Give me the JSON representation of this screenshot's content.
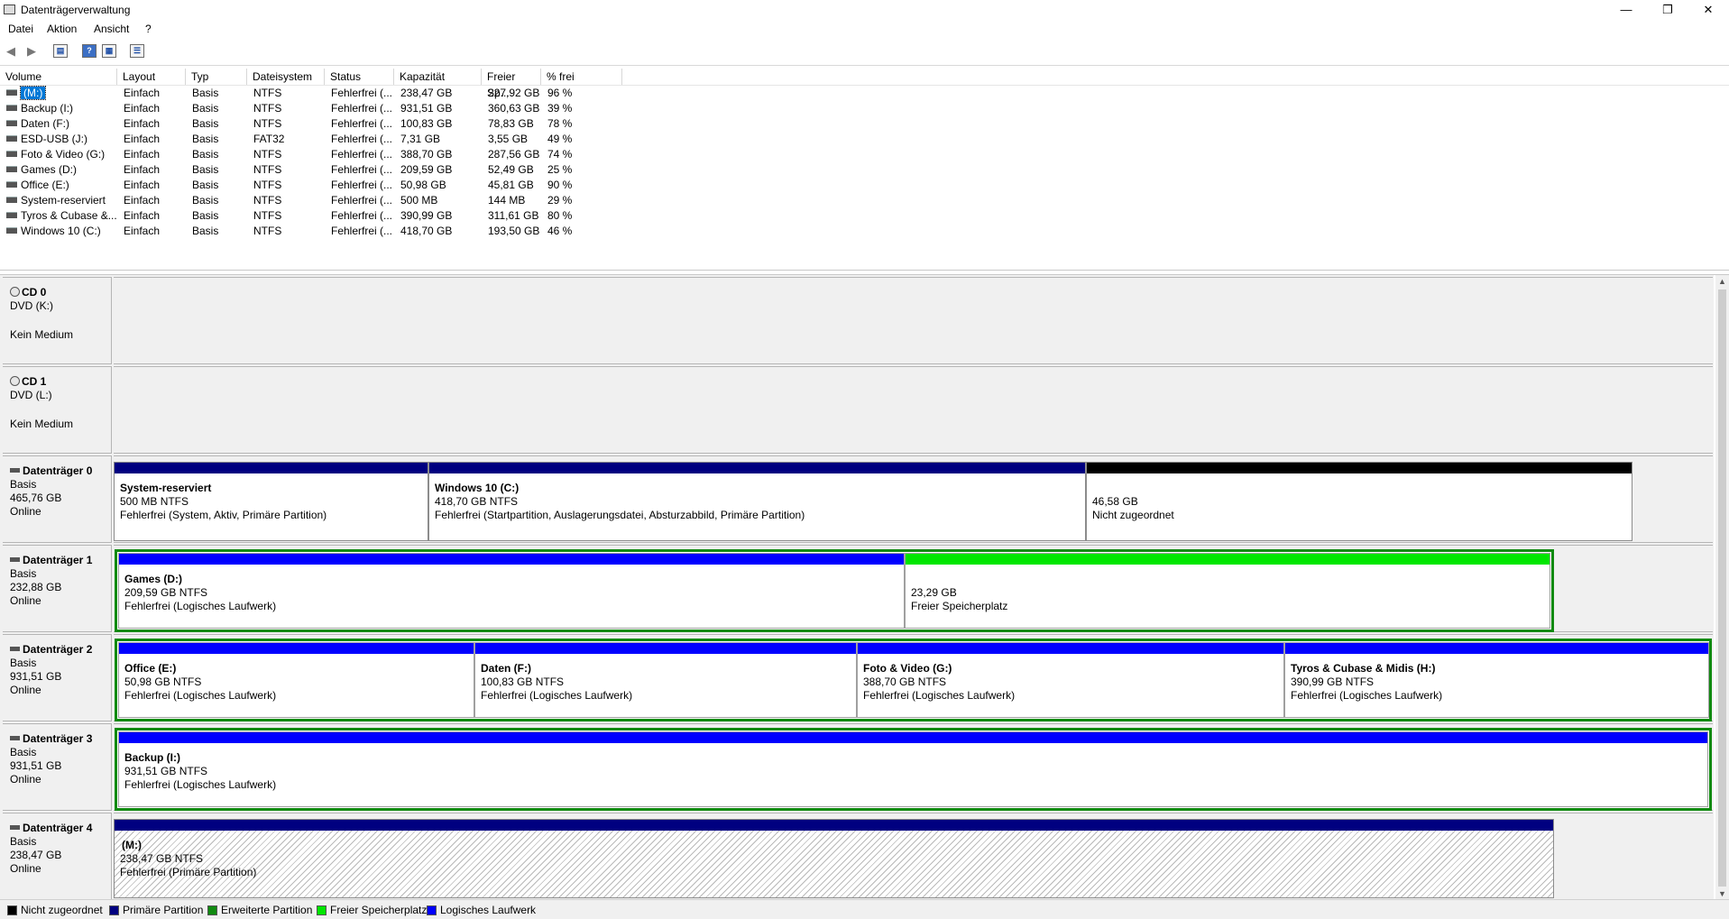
{
  "window": {
    "title": "Datenträgerverwaltung",
    "minimize": "—",
    "restore": "❐",
    "close": "✕"
  },
  "menu": [
    "Datei",
    "Aktion",
    "Ansicht",
    "?"
  ],
  "toolbar": {
    "back": "back-icon",
    "forward": "forward-icon",
    "help_label": "?"
  },
  "volume_list": {
    "headers": [
      "Volume",
      "Layout",
      "Typ",
      "Dateisystem",
      "Status",
      "Kapazität",
      "Freier Sp...",
      "% frei"
    ],
    "rows": [
      [
        "(M:)",
        "Einfach",
        "Basis",
        "NTFS",
        "Fehlerfrei (...",
        "238,47 GB",
        "227,92 GB",
        "96 %"
      ],
      [
        "Backup (I:)",
        "Einfach",
        "Basis",
        "NTFS",
        "Fehlerfrei (...",
        "931,51 GB",
        "360,63 GB",
        "39 %"
      ],
      [
        "Daten (F:)",
        "Einfach",
        "Basis",
        "NTFS",
        "Fehlerfrei (...",
        "100,83 GB",
        "78,83 GB",
        "78 %"
      ],
      [
        "ESD-USB (J:)",
        "Einfach",
        "Basis",
        "FAT32",
        "Fehlerfrei (...",
        "7,31 GB",
        "3,55 GB",
        "49 %"
      ],
      [
        "Foto & Video (G:)",
        "Einfach",
        "Basis",
        "NTFS",
        "Fehlerfrei (...",
        "388,70 GB",
        "287,56 GB",
        "74 %"
      ],
      [
        "Games (D:)",
        "Einfach",
        "Basis",
        "NTFS",
        "Fehlerfrei (...",
        "209,59 GB",
        "52,49 GB",
        "25 %"
      ],
      [
        "Office (E:)",
        "Einfach",
        "Basis",
        "NTFS",
        "Fehlerfrei (...",
        "50,98 GB",
        "45,81 GB",
        "90 %"
      ],
      [
        "System-reserviert",
        "Einfach",
        "Basis",
        "NTFS",
        "Fehlerfrei (...",
        "500 MB",
        "144 MB",
        "29 %"
      ],
      [
        "Tyros & Cubase &...",
        "Einfach",
        "Basis",
        "NTFS",
        "Fehlerfrei (...",
        "390,99 GB",
        "311,61 GB",
        "80 %"
      ],
      [
        "Windows 10 (C:)",
        "Einfach",
        "Basis",
        "NTFS",
        "Fehlerfrei (...",
        "418,70 GB",
        "193,50 GB",
        "46 %"
      ]
    ]
  },
  "disks": [
    {
      "name": "CD 0",
      "line1": "DVD (K:)",
      "line2": "",
      "line3": "Kein Medium"
    },
    {
      "name": "CD 1",
      "line1": "DVD (L:)",
      "line2": "",
      "line3": "Kein Medium"
    },
    {
      "name": "Datenträger 0",
      "line1": "Basis",
      "line2": "465,76 GB",
      "line3": "Online",
      "partitions": [
        {
          "title": "System-reserviert",
          "size": "500 MB NTFS",
          "status": "Fehlerfrei (System, Aktiv, Primäre Partition)"
        },
        {
          "title": "Windows 10  (C:)",
          "size": "418,70 GB NTFS",
          "status": "Fehlerfrei (Startpartition, Auslagerungsdatei, Absturzabbild, Primäre Partition)"
        },
        {
          "title": "",
          "size": "46,58 GB",
          "status": "Nicht zugeordnet"
        }
      ]
    },
    {
      "name": "Datenträger 1",
      "line1": "Basis",
      "line2": "232,88 GB",
      "line3": "Online",
      "partitions": [
        {
          "title": "Games  (D:)",
          "size": "209,59 GB NTFS",
          "status": "Fehlerfrei (Logisches Laufwerk)"
        },
        {
          "title": "",
          "size": "23,29 GB",
          "status": "Freier Speicherplatz"
        }
      ]
    },
    {
      "name": "Datenträger 2",
      "line1": "Basis",
      "line2": "931,51 GB",
      "line3": "Online",
      "partitions": [
        {
          "title": "Office  (E:)",
          "size": "50,98 GB NTFS",
          "status": "Fehlerfrei (Logisches Laufwerk)"
        },
        {
          "title": "Daten  (F:)",
          "size": "100,83 GB NTFS",
          "status": "Fehlerfrei (Logisches Laufwerk)"
        },
        {
          "title": "Foto & Video  (G:)",
          "size": "388,70 GB NTFS",
          "status": "Fehlerfrei (Logisches Laufwerk)"
        },
        {
          "title": "Tyros & Cubase & Midis  (H:)",
          "size": "390,99 GB NTFS",
          "status": "Fehlerfrei (Logisches Laufwerk)"
        }
      ]
    },
    {
      "name": "Datenträger 3",
      "line1": "Basis",
      "line2": "931,51 GB",
      "line3": "Online",
      "partitions": [
        {
          "title": "Backup  (I:)",
          "size": "931,51 GB NTFS",
          "status": "Fehlerfrei (Logisches Laufwerk)"
        }
      ]
    },
    {
      "name": "Datenträger 4",
      "line1": "Basis",
      "line2": "238,47 GB",
      "line3": "Online",
      "partitions": [
        {
          "title": "(M:)",
          "size": "238,47 GB NTFS",
          "status": "Fehlerfrei (Primäre Partition)"
        }
      ]
    }
  ],
  "legend": [
    {
      "label": "Nicht zugeordnet",
      "color": "#000000"
    },
    {
      "label": "Primäre Partition",
      "color": "#000080"
    },
    {
      "label": "Erweiterte Partition",
      "color": "#118a11"
    },
    {
      "label": "Freier Speicherplatz",
      "color": "#00e600"
    },
    {
      "label": "Logisches Laufwerk",
      "color": "#0000ff"
    }
  ],
  "colors": {
    "primary": "#000080",
    "logical": "#0000ff",
    "unallocated": "#000000",
    "free": "#00e600",
    "extended": "#118a11",
    "selection": "#0078d7"
  }
}
